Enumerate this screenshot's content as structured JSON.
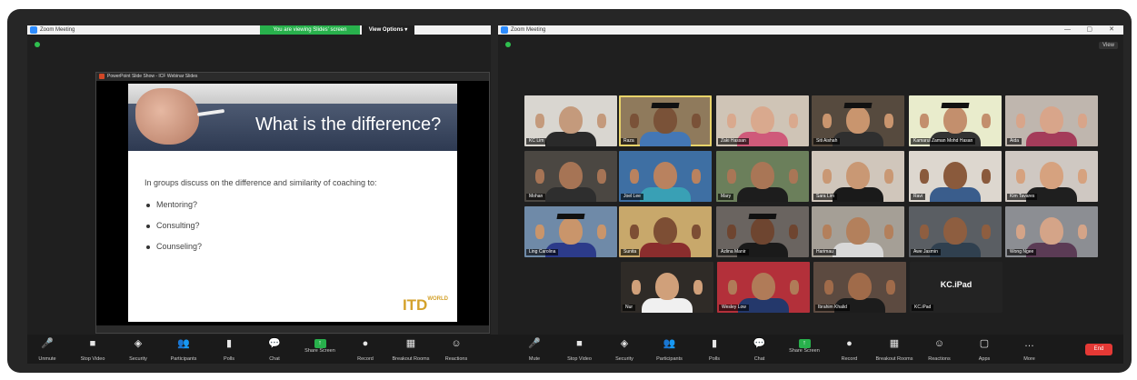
{
  "left_window": {
    "title": "Zoom Meeting",
    "share_notice": "You are viewing Slides' screen",
    "view_options": "View Options ▾"
  },
  "right_window": {
    "title": "Zoom Meeting",
    "view_label": "View"
  },
  "powerpoint": {
    "window_title": "PowerPoint Slide Show - ICF Webinar Slides",
    "slide": {
      "title": "What is the difference?",
      "body": "In groups discuss on the difference and similarity of coaching to:",
      "bullets": [
        "Mentoring?",
        "Consulting?",
        "Counseling?"
      ],
      "logo": "ITD",
      "logo_suffix": "WORLD"
    }
  },
  "participants": [
    {
      "name": "KC Lim",
      "bg": "#d9d6d0",
      "skin": "#c49a7c",
      "body": "#2a2a2a",
      "cap": false,
      "active": false
    },
    {
      "name": "Raza",
      "bg": "#8f7a5c",
      "skin": "#7a5238",
      "body": "#4477b5",
      "cap": true,
      "active": true
    },
    {
      "name": "Zaki Hassan",
      "bg": "#cfc4b6",
      "skin": "#d9a98e",
      "body": "#cf5a7a",
      "cap": false,
      "active": false
    },
    {
      "name": "Siti Aishah",
      "bg": "#564a3e",
      "skin": "#c9956e",
      "body": "#2f2f2f",
      "cap": true,
      "active": false
    },
    {
      "name": "Kamarul Zaman Mohd Hasan",
      "bg": "#e9eccc",
      "skin": "#c38f6d",
      "body": "#333333",
      "cap": true,
      "active": false
    },
    {
      "name": "Aida",
      "bg": "#bfb6ae",
      "skin": "#d8a58a",
      "body": "#a43c5a",
      "cap": false,
      "active": false
    },
    {
      "name": "Mohan",
      "bg": "#4b4742",
      "skin": "#a67455",
      "body": "#2e2e2e",
      "cap": false,
      "active": false
    },
    {
      "name": "Joel Lee",
      "bg": "#3e6fa3",
      "skin": "#b9825f",
      "body": "#39a0b5",
      "cap": false,
      "active": false
    },
    {
      "name": "Mary",
      "bg": "#6b7f5b",
      "skin": "#a97656",
      "body": "#1d1d1d",
      "cap": false,
      "active": false
    },
    {
      "name": "Sara Lim",
      "bg": "#d0c6bb",
      "skin": "#c99874",
      "body": "#1a1a1a",
      "cap": false,
      "active": false
    },
    {
      "name": "Ravi",
      "bg": "#ddd7cf",
      "skin": "#8a5a3c",
      "body": "#3a5d8c",
      "cap": false,
      "active": false
    },
    {
      "name": "Kim Tavares",
      "bg": "#cfc8c2",
      "skin": "#d6a27f",
      "body": "#1f1f1f",
      "cap": false,
      "active": false
    },
    {
      "name": "Ling Carolina",
      "bg": "#6f8aa8",
      "skin": "#c9956b",
      "body": "#2c3b8a",
      "cap": true,
      "active": false
    },
    {
      "name": "Sunita",
      "bg": "#c8a86b",
      "skin": "#7d4e34",
      "body": "#8a2d2d",
      "cap": false,
      "active": false
    },
    {
      "name": "Azlina Manir",
      "bg": "#6a6460",
      "skin": "#6e4530",
      "body": "#1a1a1a",
      "cap": true,
      "active": false
    },
    {
      "name": "Harimau",
      "bg": "#a59f96",
      "skin": "#b3805c",
      "body": "#d8d8d8",
      "cap": false,
      "active": false
    },
    {
      "name": "Awe Jasmin",
      "bg": "#5a5e63",
      "skin": "#8e5e40",
      "body": "#30404f",
      "cap": false,
      "active": false
    },
    {
      "name": "Wong Ngee",
      "bg": "#8c8e93",
      "skin": "#d4a488",
      "body": "#5b3b55",
      "cap": false,
      "active": false
    },
    {
      "name": "Nur",
      "bg": "#2f2b27",
      "skin": "#d0a07a",
      "body": "#f0f0f0",
      "cap": false,
      "active": false
    },
    {
      "name": "Wesley Low",
      "bg": "#b3303a",
      "skin": "#b07b58",
      "body": "#24386b",
      "cap": false,
      "active": false
    },
    {
      "name": "Ibrahim Khalid",
      "bg": "#5c4a40",
      "skin": "#a06b4a",
      "body": "#1c1c1c",
      "cap": false,
      "active": false
    }
  ],
  "kc_ipad": {
    "label": "KC.iPad",
    "name": "KC.iPad"
  },
  "left_toolbar": [
    {
      "icon": "🎤",
      "label": "Unmute",
      "green": false
    },
    {
      "icon": "■",
      "label": "Stop Video",
      "green": false
    },
    {
      "icon": "◈",
      "label": "Security",
      "green": false
    },
    {
      "icon": "👥",
      "label": "Participants",
      "green": false
    },
    {
      "icon": "▮",
      "label": "Polls",
      "green": false
    },
    {
      "icon": "💬",
      "label": "Chat",
      "green": false
    },
    {
      "icon": "↑",
      "label": "Share Screen",
      "green": true
    },
    {
      "icon": "●",
      "label": "Record",
      "green": false
    },
    {
      "icon": "▦",
      "label": "Breakout Rooms",
      "green": false
    },
    {
      "icon": "☺",
      "label": "Reactions",
      "green": false
    }
  ],
  "right_toolbar": [
    {
      "icon": "🎤",
      "label": "Mute",
      "green": true
    },
    {
      "icon": "■",
      "label": "Stop Video",
      "green": false
    },
    {
      "icon": "◈",
      "label": "Security",
      "green": false
    },
    {
      "icon": "👥",
      "label": "Participants",
      "green": false
    },
    {
      "icon": "▮",
      "label": "Polls",
      "green": false
    },
    {
      "icon": "💬",
      "label": "Chat",
      "green": false
    },
    {
      "icon": "↑",
      "label": "Share Screen",
      "green": true
    },
    {
      "icon": "●",
      "label": "Record",
      "green": false
    },
    {
      "icon": "▦",
      "label": "Breakout Rooms",
      "green": false
    },
    {
      "icon": "☺",
      "label": "Reactions",
      "green": false
    },
    {
      "icon": "▢",
      "label": "Apps",
      "green": false
    },
    {
      "icon": "…",
      "label": "More",
      "green": false
    }
  ],
  "end_label": "End"
}
